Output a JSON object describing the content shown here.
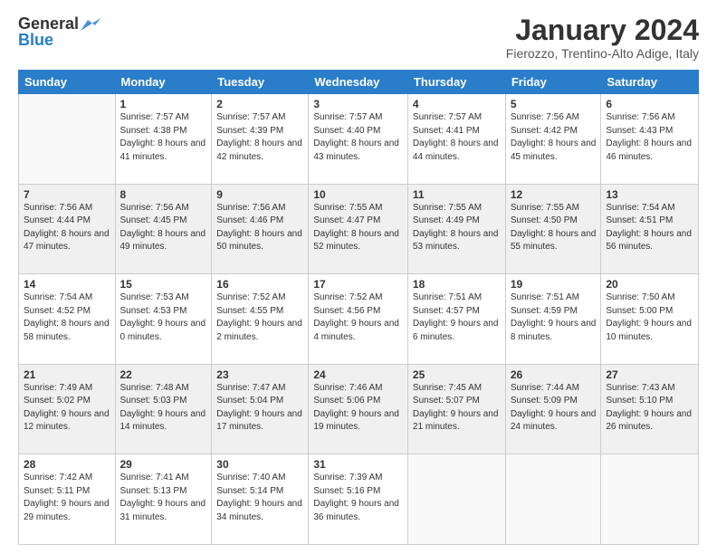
{
  "logo": {
    "line1": "General",
    "line2": "Blue"
  },
  "title": "January 2024",
  "subtitle": "Fierozzo, Trentino-Alto Adige, Italy",
  "headers": [
    "Sunday",
    "Monday",
    "Tuesday",
    "Wednesday",
    "Thursday",
    "Friday",
    "Saturday"
  ],
  "weeks": [
    [
      {
        "day": "",
        "sunrise": "",
        "sunset": "",
        "daylight": ""
      },
      {
        "day": "1",
        "sunrise": "Sunrise: 7:57 AM",
        "sunset": "Sunset: 4:38 PM",
        "daylight": "Daylight: 8 hours and 41 minutes."
      },
      {
        "day": "2",
        "sunrise": "Sunrise: 7:57 AM",
        "sunset": "Sunset: 4:39 PM",
        "daylight": "Daylight: 8 hours and 42 minutes."
      },
      {
        "day": "3",
        "sunrise": "Sunrise: 7:57 AM",
        "sunset": "Sunset: 4:40 PM",
        "daylight": "Daylight: 8 hours and 43 minutes."
      },
      {
        "day": "4",
        "sunrise": "Sunrise: 7:57 AM",
        "sunset": "Sunset: 4:41 PM",
        "daylight": "Daylight: 8 hours and 44 minutes."
      },
      {
        "day": "5",
        "sunrise": "Sunrise: 7:56 AM",
        "sunset": "Sunset: 4:42 PM",
        "daylight": "Daylight: 8 hours and 45 minutes."
      },
      {
        "day": "6",
        "sunrise": "Sunrise: 7:56 AM",
        "sunset": "Sunset: 4:43 PM",
        "daylight": "Daylight: 8 hours and 46 minutes."
      }
    ],
    [
      {
        "day": "7",
        "sunrise": "Sunrise: 7:56 AM",
        "sunset": "Sunset: 4:44 PM",
        "daylight": "Daylight: 8 hours and 47 minutes."
      },
      {
        "day": "8",
        "sunrise": "Sunrise: 7:56 AM",
        "sunset": "Sunset: 4:45 PM",
        "daylight": "Daylight: 8 hours and 49 minutes."
      },
      {
        "day": "9",
        "sunrise": "Sunrise: 7:56 AM",
        "sunset": "Sunset: 4:46 PM",
        "daylight": "Daylight: 8 hours and 50 minutes."
      },
      {
        "day": "10",
        "sunrise": "Sunrise: 7:55 AM",
        "sunset": "Sunset: 4:47 PM",
        "daylight": "Daylight: 8 hours and 52 minutes."
      },
      {
        "day": "11",
        "sunrise": "Sunrise: 7:55 AM",
        "sunset": "Sunset: 4:49 PM",
        "daylight": "Daylight: 8 hours and 53 minutes."
      },
      {
        "day": "12",
        "sunrise": "Sunrise: 7:55 AM",
        "sunset": "Sunset: 4:50 PM",
        "daylight": "Daylight: 8 hours and 55 minutes."
      },
      {
        "day": "13",
        "sunrise": "Sunrise: 7:54 AM",
        "sunset": "Sunset: 4:51 PM",
        "daylight": "Daylight: 8 hours and 56 minutes."
      }
    ],
    [
      {
        "day": "14",
        "sunrise": "Sunrise: 7:54 AM",
        "sunset": "Sunset: 4:52 PM",
        "daylight": "Daylight: 8 hours and 58 minutes."
      },
      {
        "day": "15",
        "sunrise": "Sunrise: 7:53 AM",
        "sunset": "Sunset: 4:53 PM",
        "daylight": "Daylight: 9 hours and 0 minutes."
      },
      {
        "day": "16",
        "sunrise": "Sunrise: 7:52 AM",
        "sunset": "Sunset: 4:55 PM",
        "daylight": "Daylight: 9 hours and 2 minutes."
      },
      {
        "day": "17",
        "sunrise": "Sunrise: 7:52 AM",
        "sunset": "Sunset: 4:56 PM",
        "daylight": "Daylight: 9 hours and 4 minutes."
      },
      {
        "day": "18",
        "sunrise": "Sunrise: 7:51 AM",
        "sunset": "Sunset: 4:57 PM",
        "daylight": "Daylight: 9 hours and 6 minutes."
      },
      {
        "day": "19",
        "sunrise": "Sunrise: 7:51 AM",
        "sunset": "Sunset: 4:59 PM",
        "daylight": "Daylight: 9 hours and 8 minutes."
      },
      {
        "day": "20",
        "sunrise": "Sunrise: 7:50 AM",
        "sunset": "Sunset: 5:00 PM",
        "daylight": "Daylight: 9 hours and 10 minutes."
      }
    ],
    [
      {
        "day": "21",
        "sunrise": "Sunrise: 7:49 AM",
        "sunset": "Sunset: 5:02 PM",
        "daylight": "Daylight: 9 hours and 12 minutes."
      },
      {
        "day": "22",
        "sunrise": "Sunrise: 7:48 AM",
        "sunset": "Sunset: 5:03 PM",
        "daylight": "Daylight: 9 hours and 14 minutes."
      },
      {
        "day": "23",
        "sunrise": "Sunrise: 7:47 AM",
        "sunset": "Sunset: 5:04 PM",
        "daylight": "Daylight: 9 hours and 17 minutes."
      },
      {
        "day": "24",
        "sunrise": "Sunrise: 7:46 AM",
        "sunset": "Sunset: 5:06 PM",
        "daylight": "Daylight: 9 hours and 19 minutes."
      },
      {
        "day": "25",
        "sunrise": "Sunrise: 7:45 AM",
        "sunset": "Sunset: 5:07 PM",
        "daylight": "Daylight: 9 hours and 21 minutes."
      },
      {
        "day": "26",
        "sunrise": "Sunrise: 7:44 AM",
        "sunset": "Sunset: 5:09 PM",
        "daylight": "Daylight: 9 hours and 24 minutes."
      },
      {
        "day": "27",
        "sunrise": "Sunrise: 7:43 AM",
        "sunset": "Sunset: 5:10 PM",
        "daylight": "Daylight: 9 hours and 26 minutes."
      }
    ],
    [
      {
        "day": "28",
        "sunrise": "Sunrise: 7:42 AM",
        "sunset": "Sunset: 5:11 PM",
        "daylight": "Daylight: 9 hours and 29 minutes."
      },
      {
        "day": "29",
        "sunrise": "Sunrise: 7:41 AM",
        "sunset": "Sunset: 5:13 PM",
        "daylight": "Daylight: 9 hours and 31 minutes."
      },
      {
        "day": "30",
        "sunrise": "Sunrise: 7:40 AM",
        "sunset": "Sunset: 5:14 PM",
        "daylight": "Daylight: 9 hours and 34 minutes."
      },
      {
        "day": "31",
        "sunrise": "Sunrise: 7:39 AM",
        "sunset": "Sunset: 5:16 PM",
        "daylight": "Daylight: 9 hours and 36 minutes."
      },
      {
        "day": "",
        "sunrise": "",
        "sunset": "",
        "daylight": ""
      },
      {
        "day": "",
        "sunrise": "",
        "sunset": "",
        "daylight": ""
      },
      {
        "day": "",
        "sunrise": "",
        "sunset": "",
        "daylight": ""
      }
    ]
  ]
}
